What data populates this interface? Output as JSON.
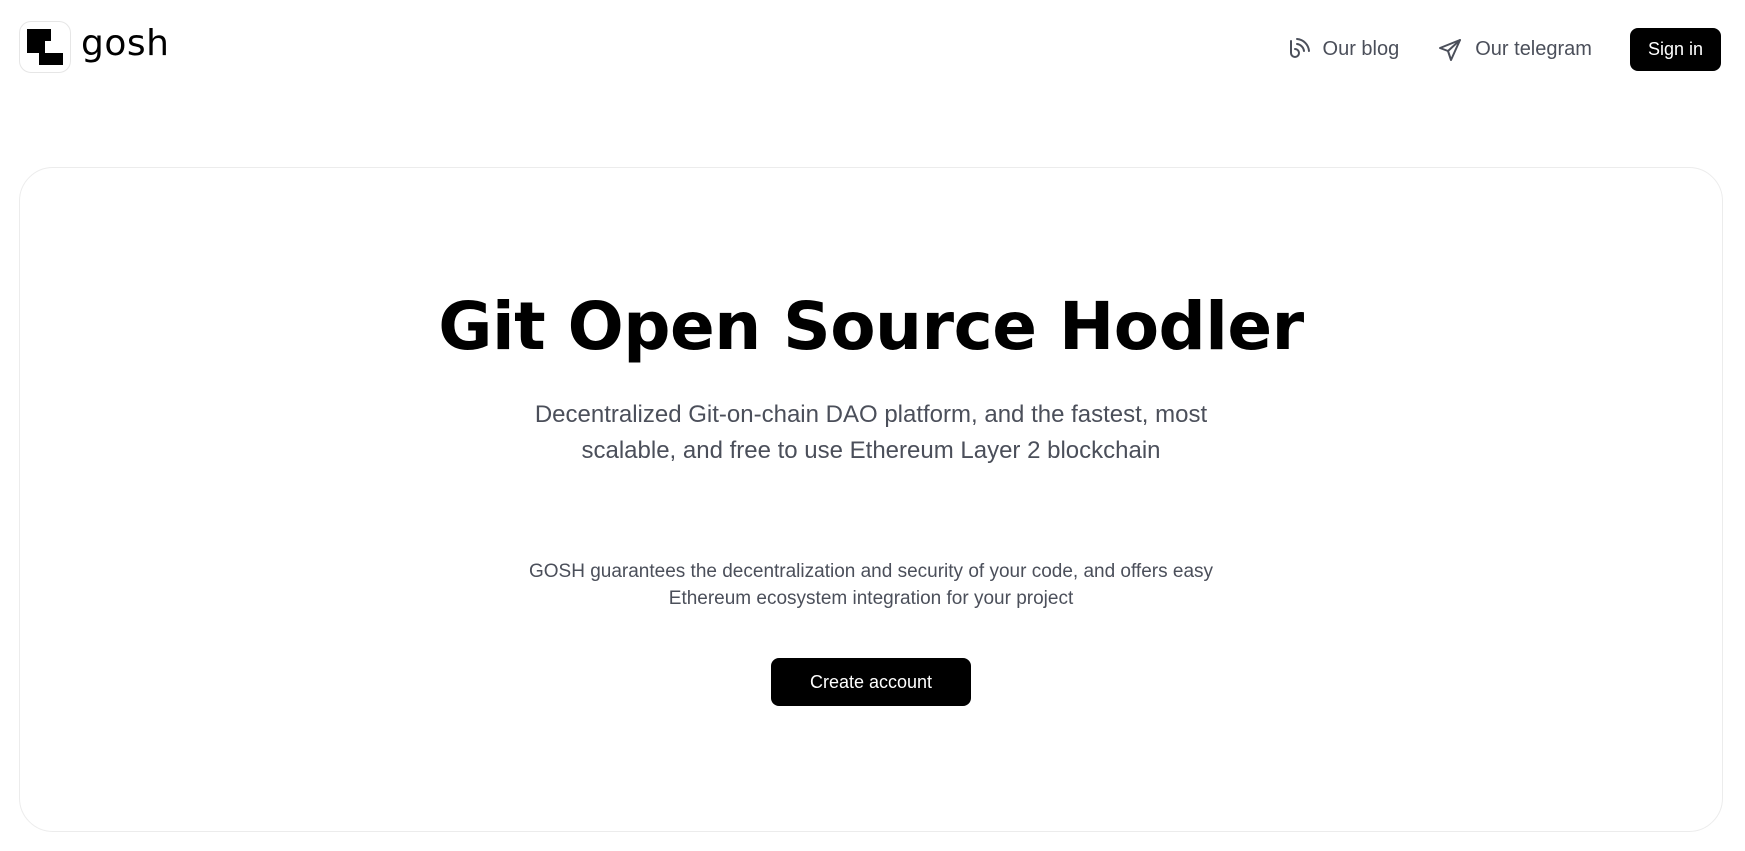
{
  "brand": {
    "name": "gosh",
    "logo_icon": "gosh-pixel-logo-icon"
  },
  "nav": {
    "blog": {
      "label": "Our blog",
      "icon": "blog-wave-icon"
    },
    "telegram": {
      "label": "Our telegram",
      "icon": "paper-plane-icon"
    },
    "signin_label": "Sign in"
  },
  "hero": {
    "title": "Git Open Source Hodler",
    "subtitle": "Decentralized Git-on-chain DAO platform, and the fastest, most scalable, and free to use Ethereum Layer 2 blockchain",
    "description": "GOSH guarantees the decentralization and security of your code, and offers easy Ethereum ecosystem integration for your project",
    "cta_label": "Create account"
  },
  "colors": {
    "primary": "#000000",
    "text_muted": "#4b4f5a",
    "border": "#ececec",
    "background": "#ffffff"
  }
}
